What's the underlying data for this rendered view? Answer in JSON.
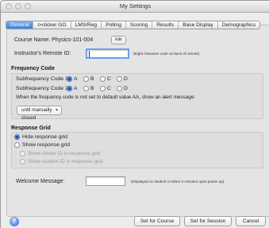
{
  "window": {
    "title": "My Settings"
  },
  "tabs": [
    {
      "label": "General",
      "active": true
    },
    {
      "label": "i>clicker GO",
      "active": false
    },
    {
      "label": "LMS/Reg",
      "active": false
    },
    {
      "label": "Polling",
      "active": false
    },
    {
      "label": "Scoring",
      "active": false
    },
    {
      "label": "Results",
      "active": false
    },
    {
      "label": "Base Display",
      "active": false
    },
    {
      "label": "Demographics",
      "active": false
    }
  ],
  "course": {
    "label": "Course Name: Physics-101-004",
    "edit_button": "Edit"
  },
  "remote_id": {
    "label": "Instructor's Remote ID:",
    "value": "",
    "hint": "(Eight character code on back of remote)"
  },
  "frequency": {
    "section_title": "Frequency Code",
    "sub1_label": "Subfrequency Code 1:",
    "sub2_label": "Subfrequency Code 2:",
    "options": [
      "A",
      "B",
      "C",
      "D"
    ],
    "sub1_selected": "A",
    "sub2_selected": "A",
    "alert_label": "When the frequency code is not set to default value AA, show an alert message:",
    "alert_select": "until manually closed"
  },
  "response_grid": {
    "section_title": "Response Grid",
    "hide_label": "Hide response grid",
    "show_label": "Show response grid",
    "show_clicker_id": "Show clicker ID in response grid",
    "show_student_id": "Show student ID in response grid",
    "selected": "hide"
  },
  "welcome": {
    "label": "Welcome Message:",
    "value": "",
    "hint": "(Displayed on student i>clicker 2 remotes upon power up)"
  },
  "footer": {
    "set_course": "Set for Course",
    "set_session": "Set for Session",
    "cancel": "Cancel",
    "help": "?"
  },
  "colors": {
    "accent": "#3d7fd9",
    "selected_radio": "#2f6fd8"
  }
}
